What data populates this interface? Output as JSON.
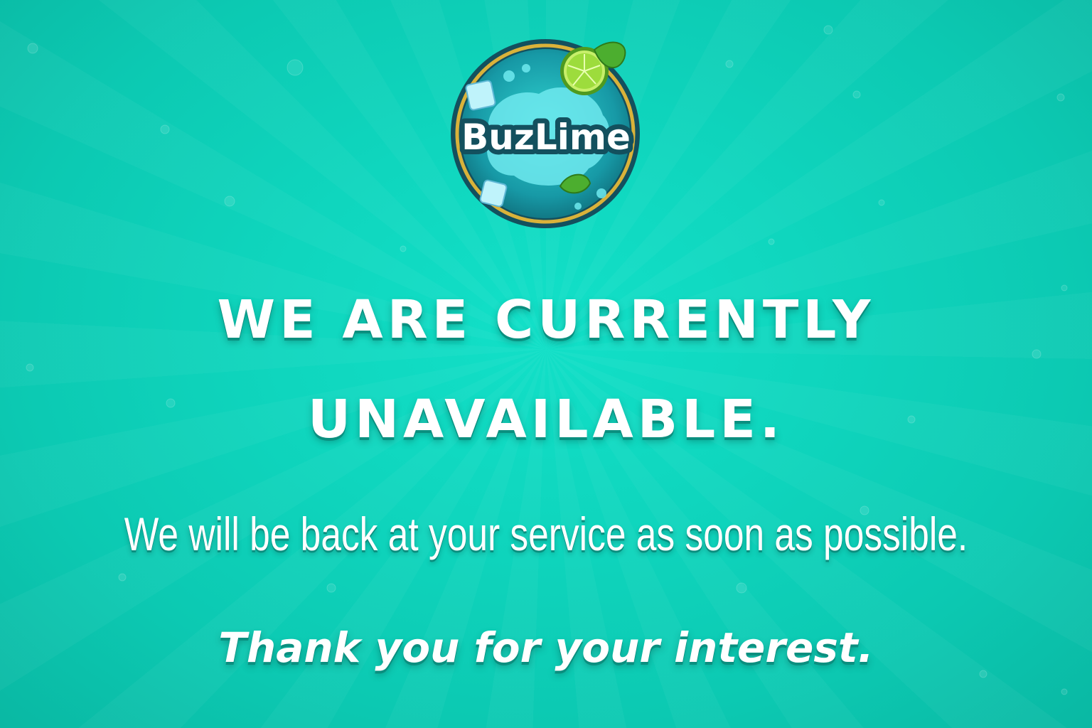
{
  "brand": {
    "logo_text": "BuzLime",
    "colors": {
      "background": "#0fd6be",
      "text": "#ffffff",
      "text_shadow": "#0a8f7f",
      "logo_ring": "#d9b23a",
      "lime": "#8cd43a"
    }
  },
  "message": {
    "headline_line1": "WE ARE CURRENTLY",
    "headline_line2": "UNAVAILABLE.",
    "subline": "We will be back at your service as soon as possible.",
    "thanks": "Thank you for your interest."
  },
  "icons": [
    "buzlime-logo",
    "lime-slice-icon",
    "mint-leaf-icon",
    "ice-cube-icon",
    "water-splash-icon"
  ]
}
